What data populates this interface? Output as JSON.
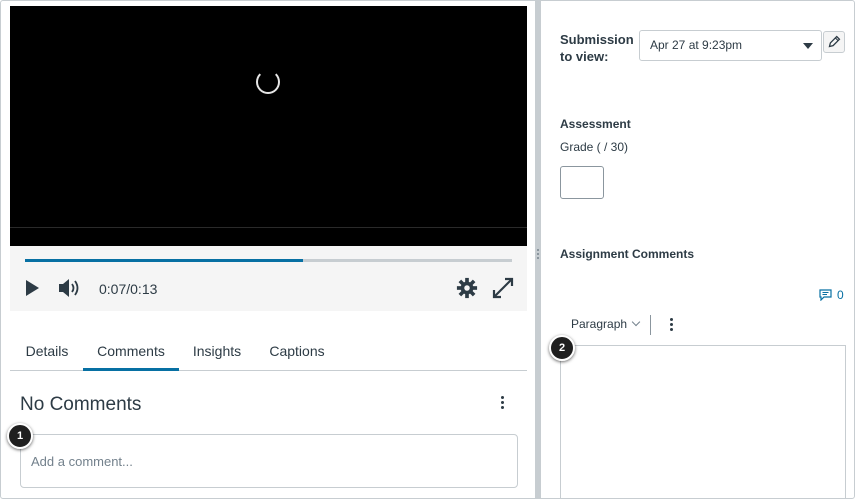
{
  "player": {
    "progress": 0.57,
    "time": "0:07/0:13"
  },
  "tabs": [
    {
      "label": "Details"
    },
    {
      "label": "Comments"
    },
    {
      "label": "Insights"
    },
    {
      "label": "Captions"
    }
  ],
  "comments": {
    "heading": "No Comments",
    "placeholder": "Add a comment..."
  },
  "callouts": {
    "one": "1",
    "two": "2"
  },
  "submission": {
    "label": "Submission to view:",
    "selected": "Apr 27 at 9:23pm"
  },
  "assessment": {
    "heading": "Assessment",
    "grade_label": "Grade ( / 30)"
  },
  "assignment_comments": {
    "heading": "Assignment Comments",
    "count": "0",
    "format": "Paragraph"
  },
  "colors": {
    "accent": "#0770a3",
    "text": "#2d3b45",
    "video_bg": "#000000"
  }
}
